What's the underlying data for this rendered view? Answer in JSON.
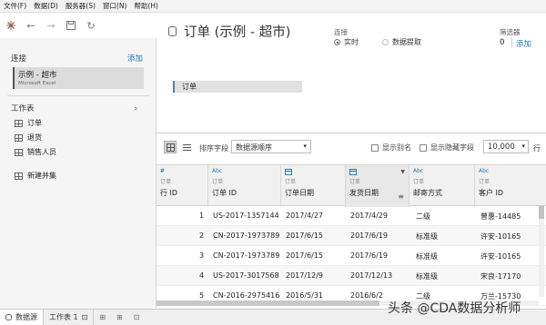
{
  "menubar": {
    "items": [
      "文件(F)",
      "数据(D)",
      "服务器(S)",
      "窗口(N)",
      "帮助(H)"
    ]
  },
  "toolbar": {
    "icons": [
      "logo-icon",
      "back-arrow-icon",
      "forward-arrow-icon",
      "save-icon",
      "refresh-icon"
    ]
  },
  "sidebar": {
    "connections_title": "连接",
    "add_label": "添加",
    "connection": {
      "name": "示例 - 超市",
      "type": "Microsoft Excel"
    },
    "sheets_title": "工作表",
    "sheets": [
      {
        "label": "订单"
      },
      {
        "label": "退货"
      },
      {
        "label": "销售人员"
      }
    ],
    "new_union": "新建并集"
  },
  "header": {
    "title": "订单 (示例 - 超市)",
    "connection_label": "连接",
    "live": "实时",
    "extract": "数据提取",
    "filters_label": "筛选器",
    "filters_count": "0",
    "filters_add": "添加"
  },
  "canvas": {
    "table_label": "订单"
  },
  "grid_toolbar": {
    "sort_label": "排序字段",
    "sort_value": "数据源顺序",
    "show_alias": "显示别名",
    "show_hidden": "显示隐藏字段",
    "row_count": "10,000",
    "rows_suffix": "行"
  },
  "grid": {
    "columns": [
      {
        "type": "#",
        "sub": "订单",
        "name": "行 ID"
      },
      {
        "type": "Abc",
        "sub": "订单",
        "name": "订单 ID"
      },
      {
        "type": "日",
        "sub": "订单",
        "name": "订单日期"
      },
      {
        "type": "日",
        "sub": "订单",
        "name": "发货日期"
      },
      {
        "type": "Abc",
        "sub": "订单",
        "name": "邮寄方式"
      },
      {
        "type": "Abc",
        "sub": "订单",
        "name": "客户 ID"
      }
    ],
    "rows": [
      [
        "1",
        "US-2017-1357144",
        "2017/4/27",
        "2017/4/29",
        "二级",
        "曾惠-14485"
      ],
      [
        "2",
        "CN-2017-1973789",
        "2017/6/15",
        "2017/6/19",
        "标准级",
        "许安-10165"
      ],
      [
        "3",
        "CN-2017-1973789",
        "2017/6/15",
        "2017/6/19",
        "标准级",
        "许安-10165"
      ],
      [
        "4",
        "US-2017-3017568",
        "2017/12/9",
        "2017/12/13",
        "标准级",
        "宋良-17170"
      ],
      [
        "5",
        "CN-2016-2975416",
        "2016/5/31",
        "2016/6/2",
        "二级",
        "万兰-15730"
      ]
    ]
  },
  "tabs": {
    "datasource": "数据源",
    "sheet1": "工作表 1"
  },
  "watermark": "头条 @CDA数据分析师"
}
